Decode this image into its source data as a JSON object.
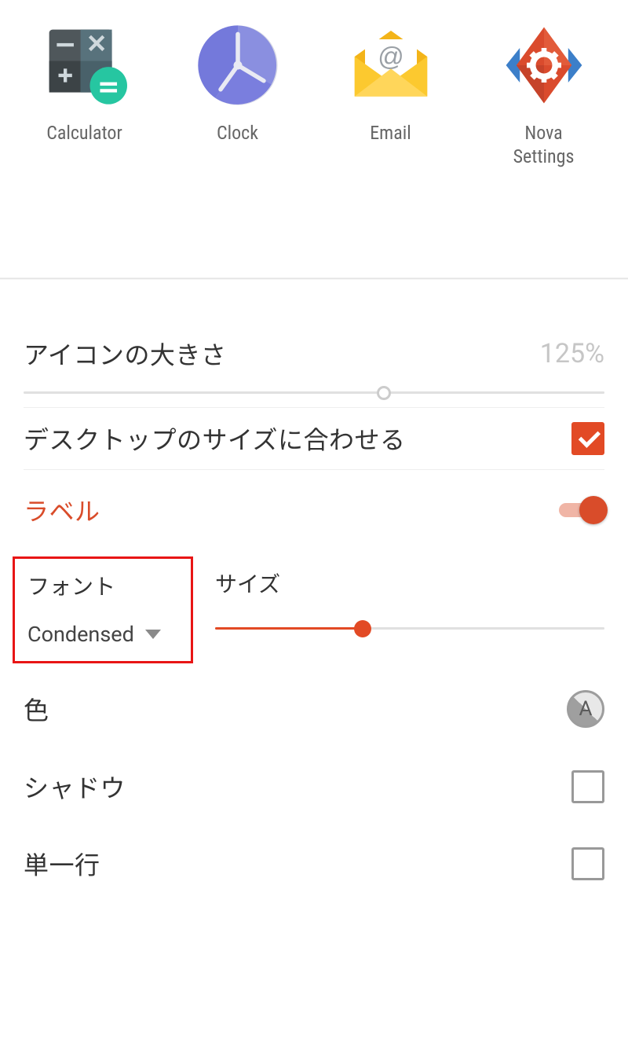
{
  "preview": {
    "apps": [
      {
        "id": "calculator",
        "label": "Calculator"
      },
      {
        "id": "clock",
        "label": "Clock"
      },
      {
        "id": "email",
        "label": "Email"
      },
      {
        "id": "nova-settings",
        "label": "Nova\nSettings"
      }
    ]
  },
  "settings": {
    "icon_size": {
      "label": "アイコンの大きさ",
      "value_text": "125%",
      "value_percent": 62
    },
    "match_desktop": {
      "label": "デスクトップのサイズに合わせる",
      "checked": true
    },
    "label_section": {
      "title": "ラベル",
      "enabled": true,
      "font": {
        "label": "フォント",
        "selected": "Condensed"
      },
      "size": {
        "label": "サイズ",
        "value_percent": 38
      },
      "color": {
        "label": "色",
        "letter": "A"
      },
      "shadow": {
        "label": "シャドウ",
        "checked": false
      },
      "single_line": {
        "label": "単一行",
        "checked": false
      }
    }
  },
  "colors": {
    "accent": "#e24a25",
    "highlight_box": "#e81515"
  }
}
